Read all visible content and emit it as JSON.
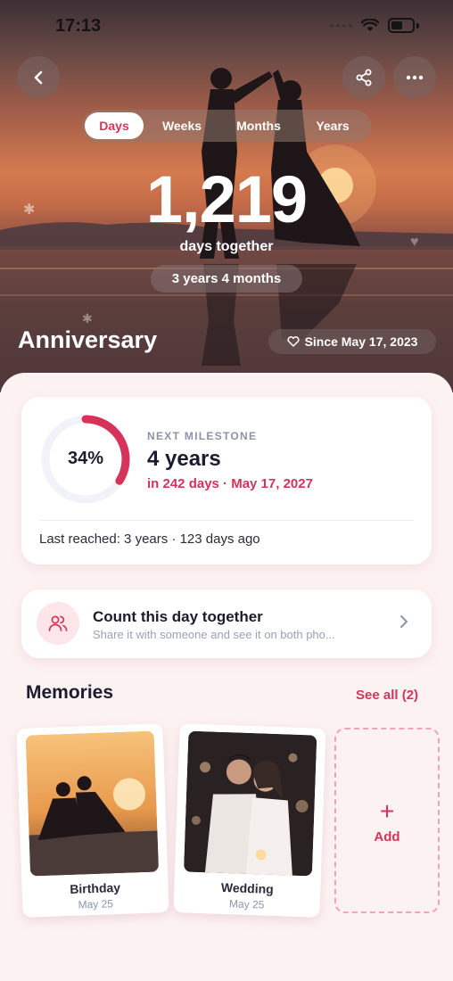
{
  "status_bar": {
    "time": "17:13"
  },
  "hero": {
    "tabs": [
      {
        "label": "Days",
        "selected": true
      },
      {
        "label": "Weeks",
        "selected": false
      },
      {
        "label": "Months",
        "selected": false
      },
      {
        "label": "Years",
        "selected": false
      }
    ],
    "count": "1,219",
    "count_label": "days together",
    "duration": "3 years 4 months",
    "title": "Anniversary",
    "since": "Since May 17, 2023"
  },
  "milestone": {
    "progress_label": "34%",
    "progress": 0.34,
    "kicker": "NEXT MILESTONE",
    "title": "4 years",
    "subtitle": "in 242 days · May 17, 2027",
    "last_reached": "Last reached: 3 years · 123 days ago"
  },
  "share": {
    "title": "Count this day together",
    "subtitle": "Share it with someone and see it on both pho..."
  },
  "memories": {
    "title": "Memories",
    "see_all": "See all (2)",
    "items": [
      {
        "caption": "Birthday",
        "date": "May 25"
      },
      {
        "caption": "Wedding",
        "date": "May 25"
      }
    ],
    "add_label": "Add"
  },
  "colors": {
    "accent": "#d6335a",
    "background": "#fdf2f2",
    "text_primary": "#1b1c2e",
    "text_muted": "#8a94a8"
  },
  "icons": {
    "back": "chevron-left-icon",
    "share": "share-icon",
    "more": "more-icon",
    "heart": "heart-icon",
    "people": "people-icon",
    "chevron": "chevron-right-icon",
    "add": "plus-icon"
  }
}
